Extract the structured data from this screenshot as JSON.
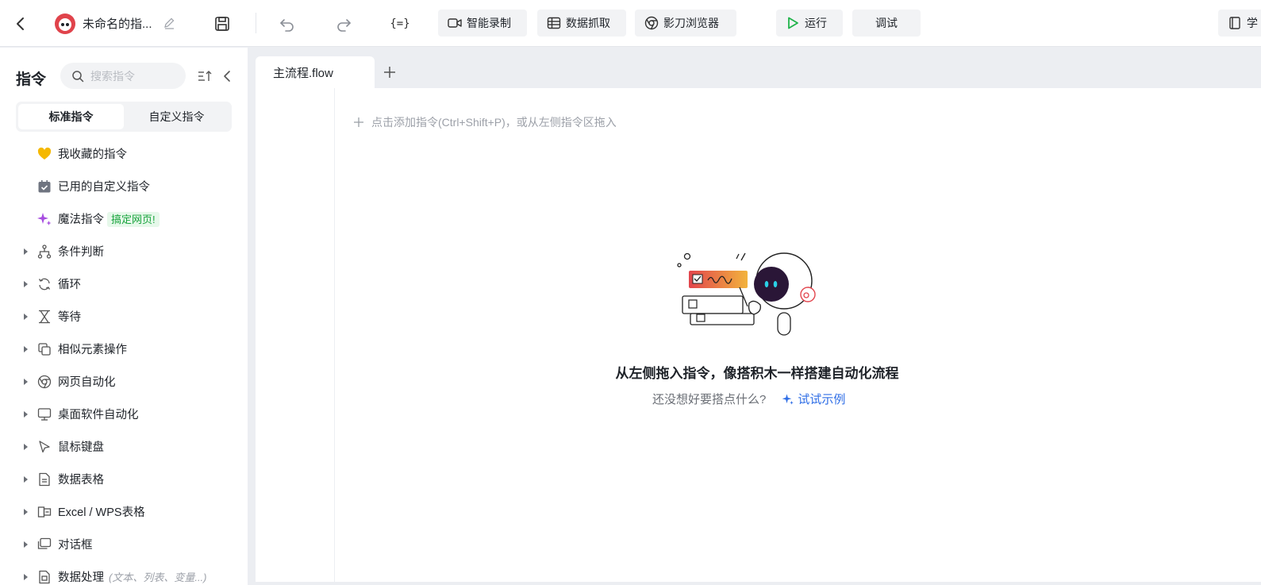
{
  "header": {
    "title": "未命名的指...",
    "vars_label": "{=}",
    "buttons": {
      "record": "智能录制",
      "grab": "数据抓取",
      "browser": "影刀浏览器",
      "run": "运行",
      "debug": "调试",
      "learn": "学"
    }
  },
  "sidebar": {
    "title": "指令",
    "search_placeholder": "搜索指令",
    "segments": [
      "标准指令",
      "自定义指令"
    ],
    "items": [
      {
        "label": "我收藏的指令",
        "icon": "heart-icon"
      },
      {
        "label": "已用的自定义指令",
        "icon": "calendar-check-icon"
      },
      {
        "label": "魔法指令",
        "icon": "sparkle-icon",
        "badge": "搞定网页!"
      },
      {
        "label": "条件判断",
        "icon": "branch-icon"
      },
      {
        "label": "循环",
        "icon": "loop-icon"
      },
      {
        "label": "等待",
        "icon": "hourglass-icon"
      },
      {
        "label": "相似元素操作",
        "icon": "copy-icon"
      },
      {
        "label": "网页自动化",
        "icon": "chrome-icon"
      },
      {
        "label": "桌面软件自动化",
        "icon": "monitor-icon"
      },
      {
        "label": "鼠标键盘",
        "icon": "cursor-icon"
      },
      {
        "label": "数据表格",
        "icon": "document-icon"
      },
      {
        "label": "Excel / WPS表格",
        "icon": "excel-icon"
      },
      {
        "label": "对话框",
        "icon": "dialog-icon"
      },
      {
        "label": "数据处理",
        "icon": "data-icon",
        "hint": "(文本、列表、变量...)"
      }
    ]
  },
  "tabs": [
    {
      "label": "主流程.flow"
    }
  ],
  "canvas": {
    "add_hint": "点击添加指令(Ctrl+Shift+P)，或从左侧指令区拖入",
    "empty_title": "从左侧拖入指令，像搭积木一样搭建自动化流程",
    "empty_subtitle": "还没想好要搭点什么?",
    "try_example": "试试示例"
  },
  "colors": {
    "accent": "#2f6ee6",
    "run_green": "#1fb34a",
    "badge_green": "#18a33c",
    "favorite_yellow": "#f5b800",
    "magic_purple": "#a64ce0"
  }
}
